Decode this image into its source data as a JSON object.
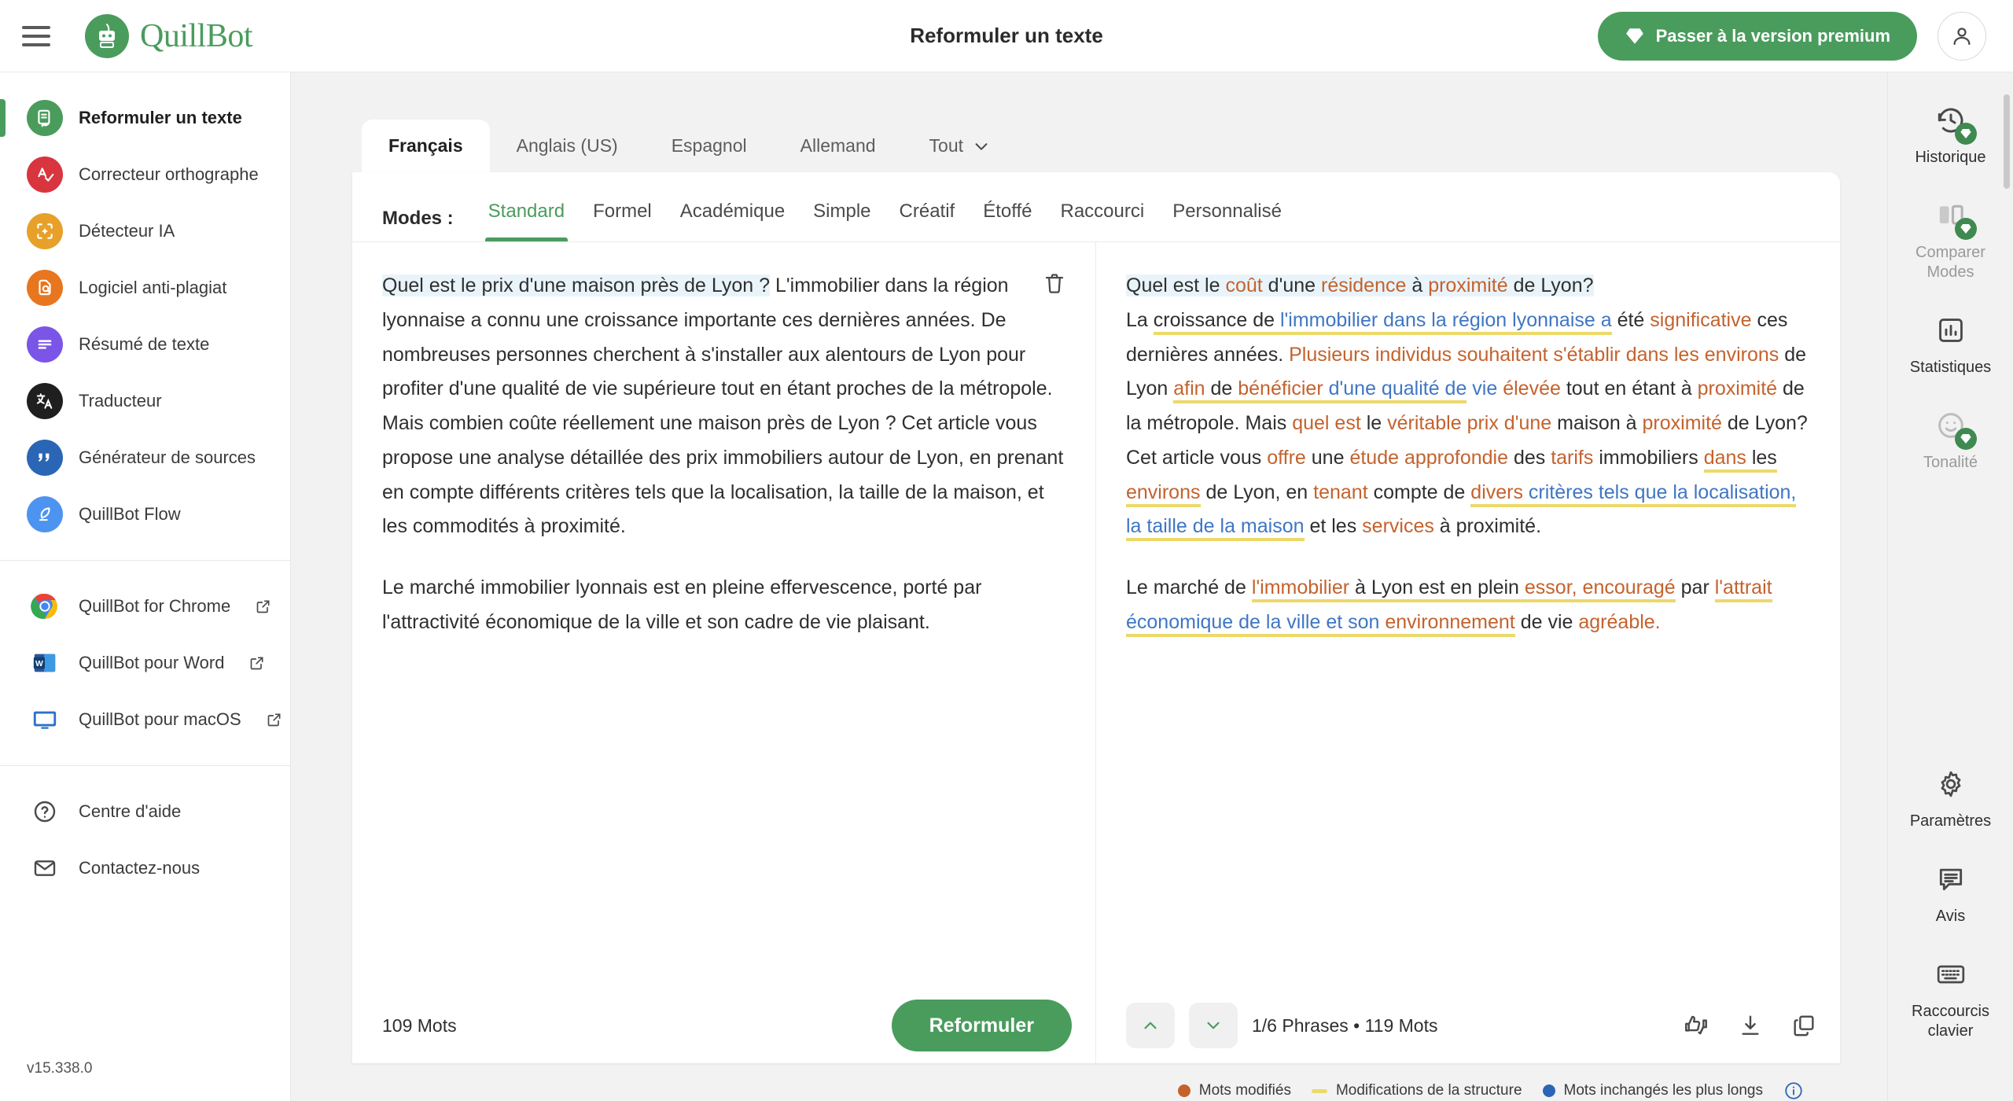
{
  "header": {
    "menu_icon": "hamburger-icon",
    "brand": "QuillBot",
    "brand_part1": "Quill",
    "brand_part2": "Bot",
    "page_title": "Reformuler un texte",
    "premium_label": "Passer à la version premium",
    "premium_icon": "diamond-icon",
    "account_icon": "user-avatar-icon"
  },
  "sidebar": {
    "tools": [
      {
        "label": "Reformuler un texte",
        "icon": "paraphrase-icon",
        "color": "#4a9c5d",
        "active": true
      },
      {
        "label": "Correcteur orthographe",
        "icon": "grammar-check-icon",
        "color": "#d8353f",
        "active": false
      },
      {
        "label": "Détecteur IA",
        "icon": "ai-detector-icon",
        "color": "#e7a12a",
        "active": false
      },
      {
        "label": "Logiciel anti-plagiat",
        "icon": "plagiarism-icon",
        "color": "#e8761f",
        "active": false
      },
      {
        "label": "Résumé de texte",
        "icon": "summarizer-icon",
        "color": "#7b55e8",
        "active": false
      },
      {
        "label": "Traducteur",
        "icon": "translator-icon",
        "color": "#1f1f1f",
        "active": false
      },
      {
        "label": "Générateur de sources",
        "icon": "citation-icon",
        "color": "#2a66b5",
        "active": false
      },
      {
        "label": "QuillBot Flow",
        "icon": "flow-feather-icon",
        "color": "#4d94f0",
        "active": false
      }
    ],
    "apps": [
      {
        "label": "QuillBot for Chrome",
        "icon": "chrome-icon",
        "external": true
      },
      {
        "label": "QuillBot pour Word",
        "icon": "word-icon",
        "external": true
      },
      {
        "label": "QuillBot pour macOS",
        "icon": "macos-monitor-icon",
        "external": true
      }
    ],
    "help": [
      {
        "label": "Centre d'aide",
        "icon": "help-circle-icon"
      },
      {
        "label": "Contactez-nous",
        "icon": "mail-icon"
      }
    ],
    "version": "v15.338.0"
  },
  "languages": {
    "tabs": [
      "Français",
      "Anglais (US)",
      "Espagnol",
      "Allemand"
    ],
    "active": "Français",
    "more_label": "Tout",
    "more_icon": "chevron-down-icon"
  },
  "modes": {
    "label": "Modes :",
    "items": [
      "Standard",
      "Formel",
      "Académique",
      "Simple",
      "Créatif",
      "Étoffé",
      "Raccourci",
      "Personnalisé"
    ],
    "active": "Standard"
  },
  "input_pane": {
    "delete_icon": "trash-icon",
    "paragraphs": [
      {
        "highlighted": "Quel est le prix d'une maison près de Lyon ?",
        "rest": "L'immobilier dans la région lyonnaise a connu une croissance importante ces dernières années. De nombreuses personnes cherchent à s'installer aux alentours de Lyon pour profiter d'une qualité de vie supérieure tout en étant proches de la métropole. Mais combien coûte réellement une maison près de Lyon ? Cet article vous propose une analyse détaillée des prix immobiliers autour de Lyon, en prenant en compte différents critères tels que la localisation, la taille de la maison, et les commodités à proximité."
      },
      {
        "highlighted": "",
        "rest": "Le marché immobilier lyonnais est en pleine effervescence, porté par l'attractivité économique de la ville et son cadre de vie plaisant."
      }
    ],
    "word_count": "109 Mots",
    "cta_label": "Reformuler"
  },
  "output_pane": {
    "tokens_p1": [
      {
        "t": "Quel est le ",
        "c": "plain",
        "hl": true
      },
      {
        "t": "coût",
        "c": "mod",
        "hl": true
      },
      {
        "t": " d'une ",
        "c": "plain",
        "hl": true
      },
      {
        "t": "résidence",
        "c": "mod",
        "hl": true
      },
      {
        "t": " à ",
        "c": "plain",
        "hl": true
      },
      {
        "t": "proximité",
        "c": "mod",
        "hl": true
      },
      {
        "t": " de Lyon?",
        "c": "plain",
        "hl": true
      },
      {
        "t": "\n",
        "c": "br"
      },
      {
        "t": "La ",
        "c": "plain"
      },
      {
        "t": "croissance de ",
        "c": "plain",
        "s": true
      },
      {
        "t": "l'immobilier dans la région lyonnaise a",
        "c": "keep",
        "s": true
      },
      {
        "t": " été ",
        "c": "plain"
      },
      {
        "t": "significative",
        "c": "mod"
      },
      {
        "t": " ces dernières années. ",
        "c": "plain"
      },
      {
        "t": "Plusieurs individus souhaitent s'établir dans les environs",
        "c": "mod"
      },
      {
        "t": " de Lyon ",
        "c": "plain"
      },
      {
        "t": "afin",
        "c": "mod",
        "s": true
      },
      {
        "t": " de ",
        "c": "plain",
        "s": true
      },
      {
        "t": "bénéficier",
        "c": "mod",
        "s": true
      },
      {
        "t": " d'une qualité de",
        "c": "keep",
        "s": true
      },
      {
        "t": " vie",
        "c": "keep"
      },
      {
        "t": " élevée",
        "c": "mod"
      },
      {
        "t": " tout en étant à ",
        "c": "plain"
      },
      {
        "t": "proximité",
        "c": "mod"
      },
      {
        "t": " de la métropole. Mais ",
        "c": "plain"
      },
      {
        "t": "quel est",
        "c": "mod"
      },
      {
        "t": " le ",
        "c": "plain"
      },
      {
        "t": "véritable prix d'une",
        "c": "mod"
      },
      {
        "t": " maison à ",
        "c": "plain"
      },
      {
        "t": "proximité",
        "c": "mod"
      },
      {
        "t": " de Lyon? Cet article vous ",
        "c": "plain"
      },
      {
        "t": "offre",
        "c": "mod"
      },
      {
        "t": " une ",
        "c": "plain"
      },
      {
        "t": "étude approfondie",
        "c": "mod"
      },
      {
        "t": " des ",
        "c": "plain"
      },
      {
        "t": "tarifs",
        "c": "mod"
      },
      {
        "t": " immobiliers ",
        "c": "plain"
      },
      {
        "t": "dans",
        "c": "mod",
        "s": true
      },
      {
        "t": " les ",
        "c": "plain",
        "s": true
      },
      {
        "t": "environs",
        "c": "mod",
        "s": true
      },
      {
        "t": " de Lyon, en ",
        "c": "plain"
      },
      {
        "t": "tenant",
        "c": "mod"
      },
      {
        "t": " compte de ",
        "c": "plain"
      },
      {
        "t": "divers",
        "c": "mod",
        "s": true
      },
      {
        "t": " critères tels que la localisation,",
        "c": "keep",
        "s": true
      },
      {
        "t": " la taille de la maison",
        "c": "keep",
        "s": true
      },
      {
        "t": " et les ",
        "c": "plain"
      },
      {
        "t": "services",
        "c": "mod"
      },
      {
        "t": " à proximité.",
        "c": "plain"
      }
    ],
    "tokens_p2": [
      {
        "t": "Le marché de ",
        "c": "plain"
      },
      {
        "t": "l'immobilier",
        "c": "mod",
        "s": true
      },
      {
        "t": " à Lyon est en plein ",
        "c": "plain",
        "s": true
      },
      {
        "t": "essor, encouragé",
        "c": "mod",
        "s": true
      },
      {
        "t": " par ",
        "c": "plain"
      },
      {
        "t": "l'attrait",
        "c": "mod",
        "s": true
      },
      {
        "t": " économique de la ville et son ",
        "c": "keep",
        "s": true
      },
      {
        "t": "environnement",
        "c": "mod",
        "s": true
      },
      {
        "t": " de vie ",
        "c": "plain"
      },
      {
        "t": "agréable.",
        "c": "mod"
      }
    ],
    "prev_icon": "chevron-up-icon",
    "next_icon": "chevron-down-icon",
    "status": "1/6 Phrases  •  119 Mots",
    "status_sentences": "1/6 Phrases",
    "status_words": "119 Mots",
    "actions": [
      {
        "icon": "thumbs-feedback-icon",
        "name": "feedback"
      },
      {
        "icon": "download-icon",
        "name": "download"
      },
      {
        "icon": "copy-icon",
        "name": "copy"
      }
    ]
  },
  "legend": {
    "items": [
      {
        "label": "Mots modifiés",
        "marker": "dot",
        "color": "#c4622d"
      },
      {
        "label": "Modifications de la structure",
        "marker": "dash",
        "color": "#ecd96a"
      },
      {
        "label": "Mots inchangés les plus longs",
        "marker": "dot",
        "color": "#2a66b5"
      }
    ],
    "info_icon": "info-icon"
  },
  "rail": {
    "items": [
      {
        "label": "Historique",
        "icon": "history-icon",
        "premium": true,
        "dim": false
      },
      {
        "label": "Comparer Modes",
        "icon": "compare-modes-icon",
        "premium": true,
        "dim": true
      },
      {
        "label": "Statistiques",
        "icon": "statistics-icon",
        "premium": false,
        "dim": false
      },
      {
        "label": "Tonalité",
        "icon": "tone-smiley-icon",
        "premium": true,
        "dim": true
      }
    ],
    "bottom_items": [
      {
        "label": "Paramètres",
        "icon": "gear-icon"
      },
      {
        "label": "Avis",
        "icon": "feedback-bubble-icon"
      },
      {
        "label": "Raccourcis clavier",
        "icon": "keyboard-icon"
      }
    ]
  },
  "colors": {
    "brand_green": "#4a9c5d",
    "modified_orange": "#c4622d",
    "unchanged_blue": "#3f76c4",
    "structure_yellow": "#ecd96a",
    "active_sentence_bg": "#e9f4fa"
  }
}
